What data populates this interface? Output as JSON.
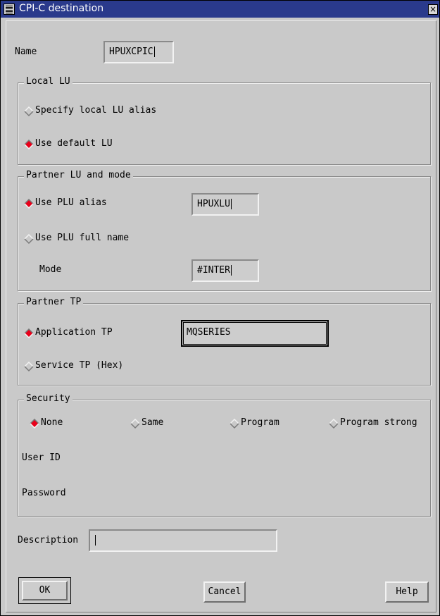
{
  "window": {
    "title": "CPI-C destination",
    "close_glyph": "×"
  },
  "name_field": {
    "label": "Name",
    "value": "HPUXCPIC"
  },
  "local_lu": {
    "legend": "Local LU",
    "options": [
      {
        "label": "Specify local LU alias",
        "selected": false
      },
      {
        "label": "Use default LU",
        "selected": true
      }
    ]
  },
  "partner_lu": {
    "legend": "Partner LU and mode",
    "plu_alias": {
      "label": "Use PLU alias",
      "selected": true,
      "value": "HPUXLU"
    },
    "plu_fullname": {
      "label": "Use PLU full name",
      "selected": false
    },
    "mode": {
      "label": "Mode",
      "value": "#INTER"
    }
  },
  "partner_tp": {
    "legend": "Partner TP",
    "application": {
      "label": "Application TP",
      "selected": true,
      "value": "MQSERIES"
    },
    "service": {
      "label": "Service TP (Hex)",
      "selected": false
    }
  },
  "security": {
    "legend": "Security",
    "options": [
      {
        "label": "None",
        "selected": true
      },
      {
        "label": "Same",
        "selected": false
      },
      {
        "label": "Program",
        "selected": false
      },
      {
        "label": "Program strong",
        "selected": false
      }
    ],
    "user_id_label": "User ID",
    "password_label": "Password"
  },
  "description": {
    "label": "Description",
    "value": ""
  },
  "buttons": {
    "ok": "OK",
    "cancel": "Cancel",
    "help": "Help"
  },
  "colors": {
    "titlebar": "#2a3a8c",
    "radio_selected": "#e8001a",
    "dialog_bg": "#c9c9c9"
  }
}
